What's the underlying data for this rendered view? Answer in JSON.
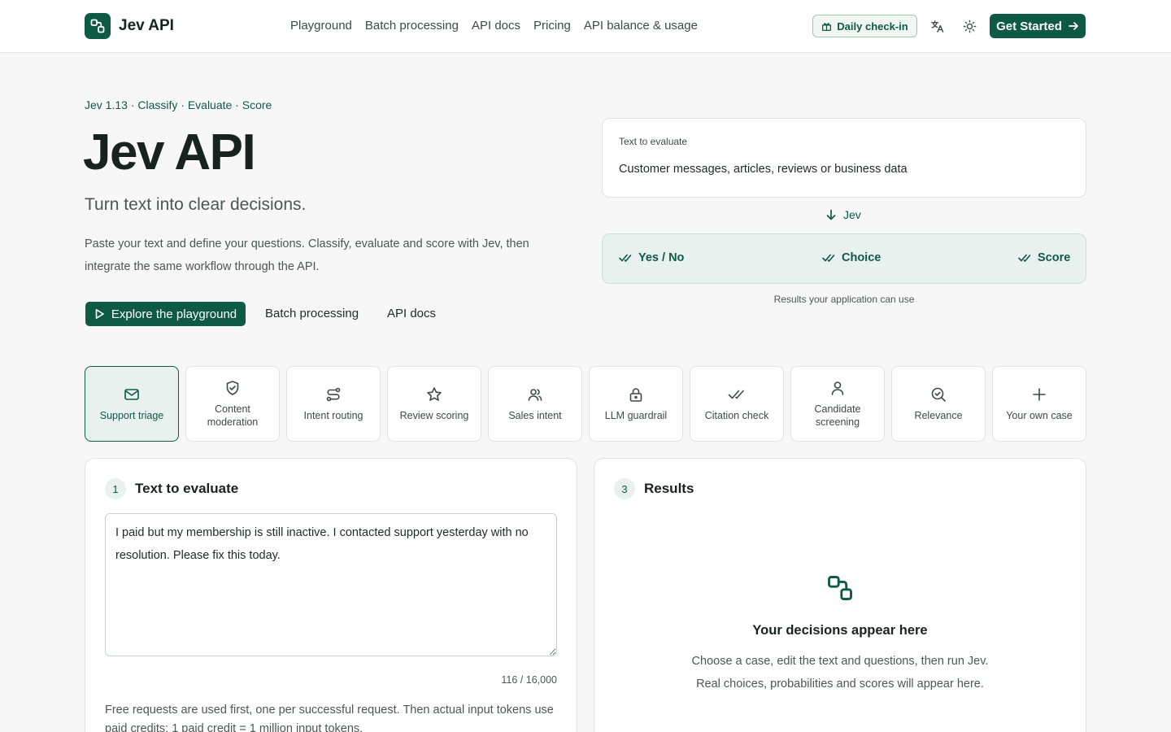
{
  "brand": {
    "name": "Jev API",
    "logo_icon": "link-nodes-icon",
    "accent": "#0f5a45"
  },
  "nav": {
    "links": [
      "Playground",
      "Batch processing",
      "API docs",
      "Pricing",
      "API balance & usage"
    ],
    "checkin_label": "Daily check-in",
    "translate_icon": "translate-icon",
    "theme_icon": "sun-icon",
    "get_started_label": "Get Started"
  },
  "hero": {
    "eyebrow": "Jev 1.13 · Classify · Evaluate · Score",
    "title": "Jev API",
    "subtitle": "Turn text into clear decisions.",
    "description": "Paste your text and define your questions. Classify, evaluate and score with Jev, then integrate the same workflow through the API.",
    "primary_cta": "Explore the playground",
    "secondary_cta": "Batch processing",
    "tertiary_cta": "API docs"
  },
  "flow": {
    "input_label": "Text to evaluate",
    "input_value": "Customer messages, articles, reviews or business data",
    "arrow_label": "Jev",
    "outputs": [
      "Yes / No",
      "Choice",
      "Score"
    ],
    "note": "Results your application can use"
  },
  "cases": [
    {
      "label": "Support triage",
      "icon": "mail-icon",
      "active": true
    },
    {
      "label": "Content moderation",
      "icon": "shield-check-icon",
      "active": false
    },
    {
      "label": "Intent routing",
      "icon": "route-icon",
      "active": false
    },
    {
      "label": "Review scoring",
      "icon": "star-icon",
      "active": false
    },
    {
      "label": "Sales intent",
      "icon": "users-icon",
      "active": false
    },
    {
      "label": "LLM guardrail",
      "icon": "lock-icon",
      "active": false
    },
    {
      "label": "Citation check",
      "icon": "double-check-icon",
      "active": false
    },
    {
      "label": "Candidate screening",
      "icon": "user-icon",
      "active": false
    },
    {
      "label": "Relevance",
      "icon": "search-check-icon",
      "active": false
    },
    {
      "label": "Your own case",
      "icon": "plus-icon",
      "active": false
    }
  ],
  "input_panel": {
    "step": "1",
    "title": "Text to evaluate",
    "text": "I paid but my membership is still inactive. I contacted support yesterday with no resolution. Please fix this today.",
    "char_count": "116 / 16,000",
    "credits_note": "Free requests are used first, one per successful request. Then actual input tokens use paid credits: 1 paid credit = 1 million input tokens."
  },
  "results_panel": {
    "step": "3",
    "title": "Results",
    "empty_title": "Your decisions appear here",
    "empty_desc_1": "Choose a case, edit the text and questions, then run Jev.",
    "empty_desc_2": "Real choices, probabilities and scores will appear here."
  }
}
